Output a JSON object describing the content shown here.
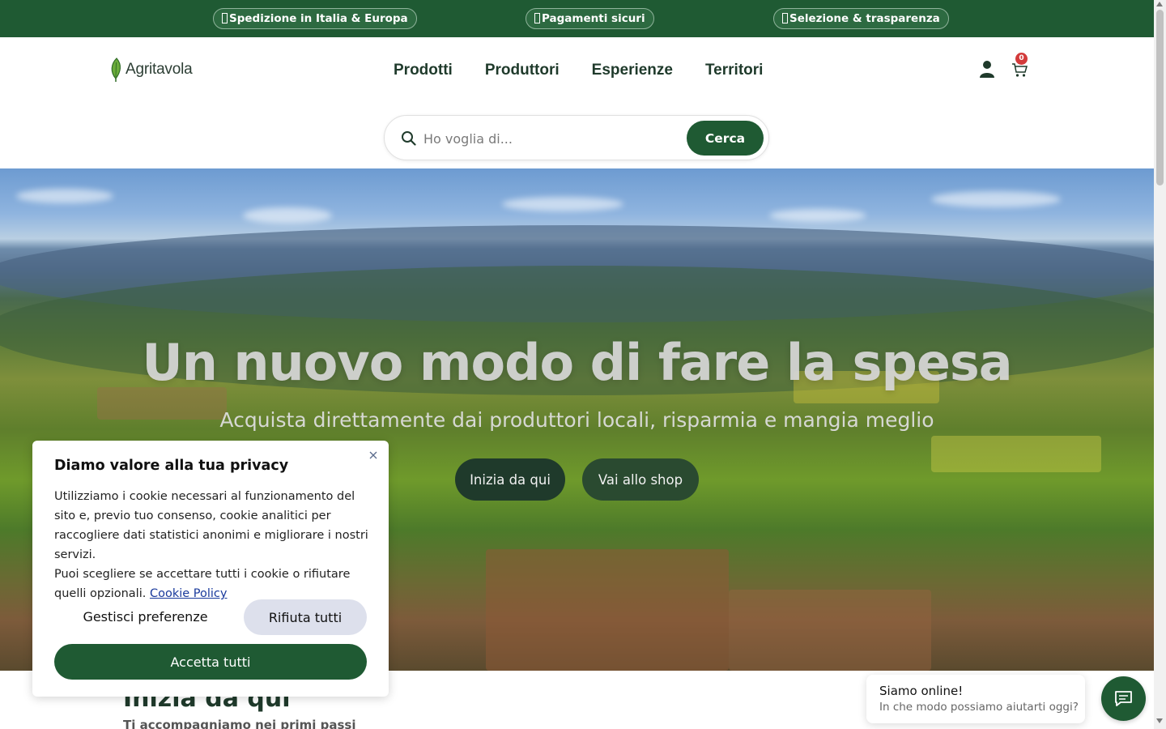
{
  "topbar": {
    "items": [
      {
        "label": "Spedizione in Italia & Europa",
        "icon": "truck-icon"
      },
      {
        "label": "Pagamenti sicuri",
        "icon": "lock-icon"
      },
      {
        "label": "Selezione & trasparenza",
        "icon": "check-icon"
      }
    ]
  },
  "header": {
    "logo_text": "Agritavola",
    "nav": [
      "Prodotti",
      "Produttori",
      "Esperienze",
      "Territori"
    ],
    "cart_count": "0"
  },
  "search": {
    "placeholder": "Ho voglia di...",
    "button_label": "Cerca"
  },
  "hero": {
    "title": "Un nuovo modo di fare la spesa",
    "subtitle": "Acquista direttamente dai produttori locali, risparmia e mangia meglio",
    "primary_button": "Inizia da qui",
    "secondary_button": "Vai allo shop"
  },
  "section": {
    "title": "Inizia da qui",
    "subtitle": "Ti accompagniamo nei primi passi"
  },
  "cookie": {
    "title": "Diamo valore alla tua privacy",
    "text": "Utilizziamo i cookie necessari al funzionamento del sito e, previo tuo consenso, cookie analitici per raccogliere dati statistici anonimi e migliorare i nostri servizi.",
    "text2": "Puoi scegliere se accettare tutti i cookie o rifiutare quelli opzionali.",
    "policy_link": "Cookie Policy",
    "manage_label": "Gestisci preferenze",
    "reject_label": "Rifiuta tutti",
    "accept_label": "Accetta tutti"
  },
  "chat": {
    "title": "Siamo online!",
    "subtitle": "In che modo possiamo aiutarti oggi?"
  },
  "colors": {
    "brand_green": "#1f5a33",
    "dark_green": "#1f3a2b",
    "badge_red": "#d33b3b"
  }
}
